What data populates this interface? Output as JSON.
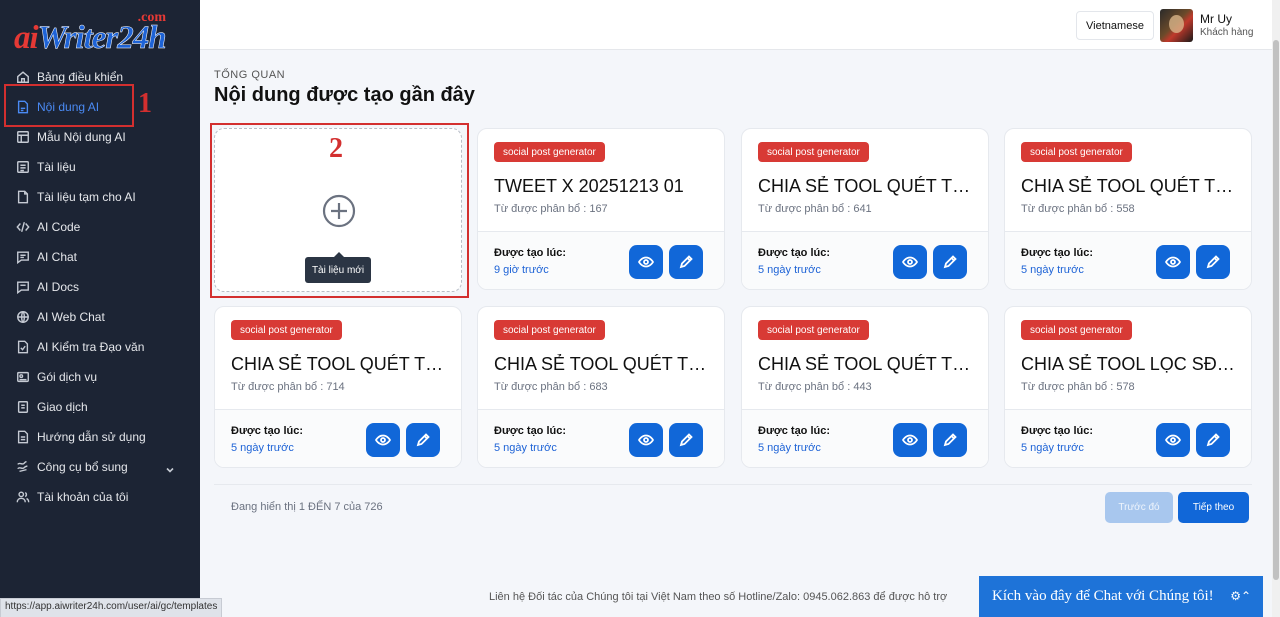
{
  "logo": {
    "com": ".com",
    "ai": "ai",
    "rest": "Writer24h"
  },
  "sidebar": {
    "items": [
      {
        "label": "Bảng điều khiển",
        "icon": "home-icon"
      },
      {
        "label": "Nội dung AI",
        "icon": "document-ai-icon",
        "active": true
      },
      {
        "label": "Mẫu Nội dung AI",
        "icon": "template-icon"
      },
      {
        "label": "Tài liệu",
        "icon": "list-icon"
      },
      {
        "label": "Tài liệu tạm cho AI",
        "icon": "file-icon"
      },
      {
        "label": "AI Code",
        "icon": "code-icon"
      },
      {
        "label": "AI Chat",
        "icon": "chat-icon"
      },
      {
        "label": "AI Docs",
        "icon": "docs-chat-icon"
      },
      {
        "label": "AI Web Chat",
        "icon": "globe-icon"
      },
      {
        "label": "AI Kiểm tra Đạo văn",
        "icon": "file-check-icon"
      },
      {
        "label": "Gói dịch vụ",
        "icon": "package-icon"
      },
      {
        "label": "Giao dịch",
        "icon": "receipt-icon"
      },
      {
        "label": "Hướng dẫn sử dụng",
        "icon": "book-icon"
      },
      {
        "label": "Công cụ bổ sung",
        "icon": "tools-icon"
      },
      {
        "label": "Tài khoản của tôi",
        "icon": "users-icon"
      }
    ]
  },
  "annotations": {
    "one": "1",
    "two": "2"
  },
  "status_url": "https://app.aiwriter24h.com/user/ai/gc/templates",
  "header": {
    "language": "Vietnamese",
    "user_name": "Mr Uy",
    "user_role": "Khách hàng"
  },
  "main": {
    "breadcrumb": "TỔNG QUAN",
    "title": "Nội dung được tạo gần đây",
    "new_doc_tooltip": "Tài liệu mới",
    "cards": [
      {
        "badge": "social post generator",
        "title": "TWEET X 20251213 01",
        "sub": "Từ được phân bổ : 167",
        "created_label": "Được tạo lúc:",
        "created": "9 giờ trước"
      },
      {
        "badge": "social post generator",
        "title": "CHIA SẺ TOOL QUÉT TR...",
        "sub": "Từ được phân bổ : 641",
        "created_label": "Được tạo lúc:",
        "created": "5 ngày trước"
      },
      {
        "badge": "social post generator",
        "title": "CHIA SẺ TOOL QUÉT TR...",
        "sub": "Từ được phân bổ : 558",
        "created_label": "Được tạo lúc:",
        "created": "5 ngày trước"
      },
      {
        "badge": "social post generator",
        "title": "CHIA SẺ TOOL QUÉT TR...",
        "sub": "Từ được phân bổ : 714",
        "created_label": "Được tạo lúc:",
        "created": "5 ngày trước"
      },
      {
        "badge": "social post generator",
        "title": "CHIA SẺ TOOL QUÉT TR...",
        "sub": "Từ được phân bổ : 683",
        "created_label": "Được tạo lúc:",
        "created": "5 ngày trước"
      },
      {
        "badge": "social post generator",
        "title": "CHIA SẺ TOOL QUÉT TR...",
        "sub": "Từ được phân bổ : 443",
        "created_label": "Được tạo lúc:",
        "created": "5 ngày trước"
      },
      {
        "badge": "social post generator",
        "title": "CHIA SẺ TOOL LỌC SĐT ...",
        "sub": "Từ được phân bổ : 578",
        "created_label": "Được tạo lúc:",
        "created": "5 ngày trước"
      }
    ],
    "pagination": {
      "info": "Đang hiển thị 1 ĐẾN 7 của 726",
      "prev": "Trước đó",
      "next": "Tiếp theo"
    }
  },
  "footer": {
    "text": "Liên hệ Đối tác của Chúng tôi tại Việt Nam theo số Hotline/Zalo: 0945.062.863 để được hỗ trợ",
    "chat": "Kích vào đây để Chat với Chúng tôi!"
  },
  "colors": {
    "accent": "#1167d8",
    "badge": "#d83a35",
    "sidebar": "#1c2434",
    "annotation": "#d32f2f"
  }
}
